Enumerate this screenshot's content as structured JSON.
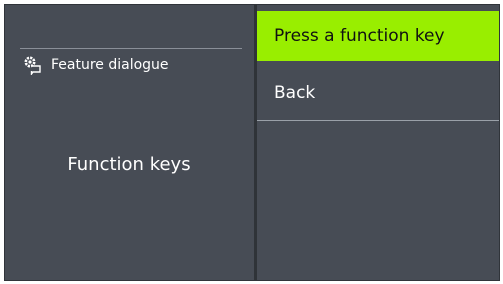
{
  "left_panel": {
    "feature_label": "Feature dialogue",
    "feature_icon": "settings-chat-icon",
    "title": "Function keys"
  },
  "menu": {
    "items": [
      {
        "label": "Press a function key",
        "selected": true
      },
      {
        "label": "Back",
        "selected": false
      }
    ],
    "selected_color": "#99ee00"
  },
  "colors": {
    "background": "#474c55",
    "text": "#ffffff"
  }
}
